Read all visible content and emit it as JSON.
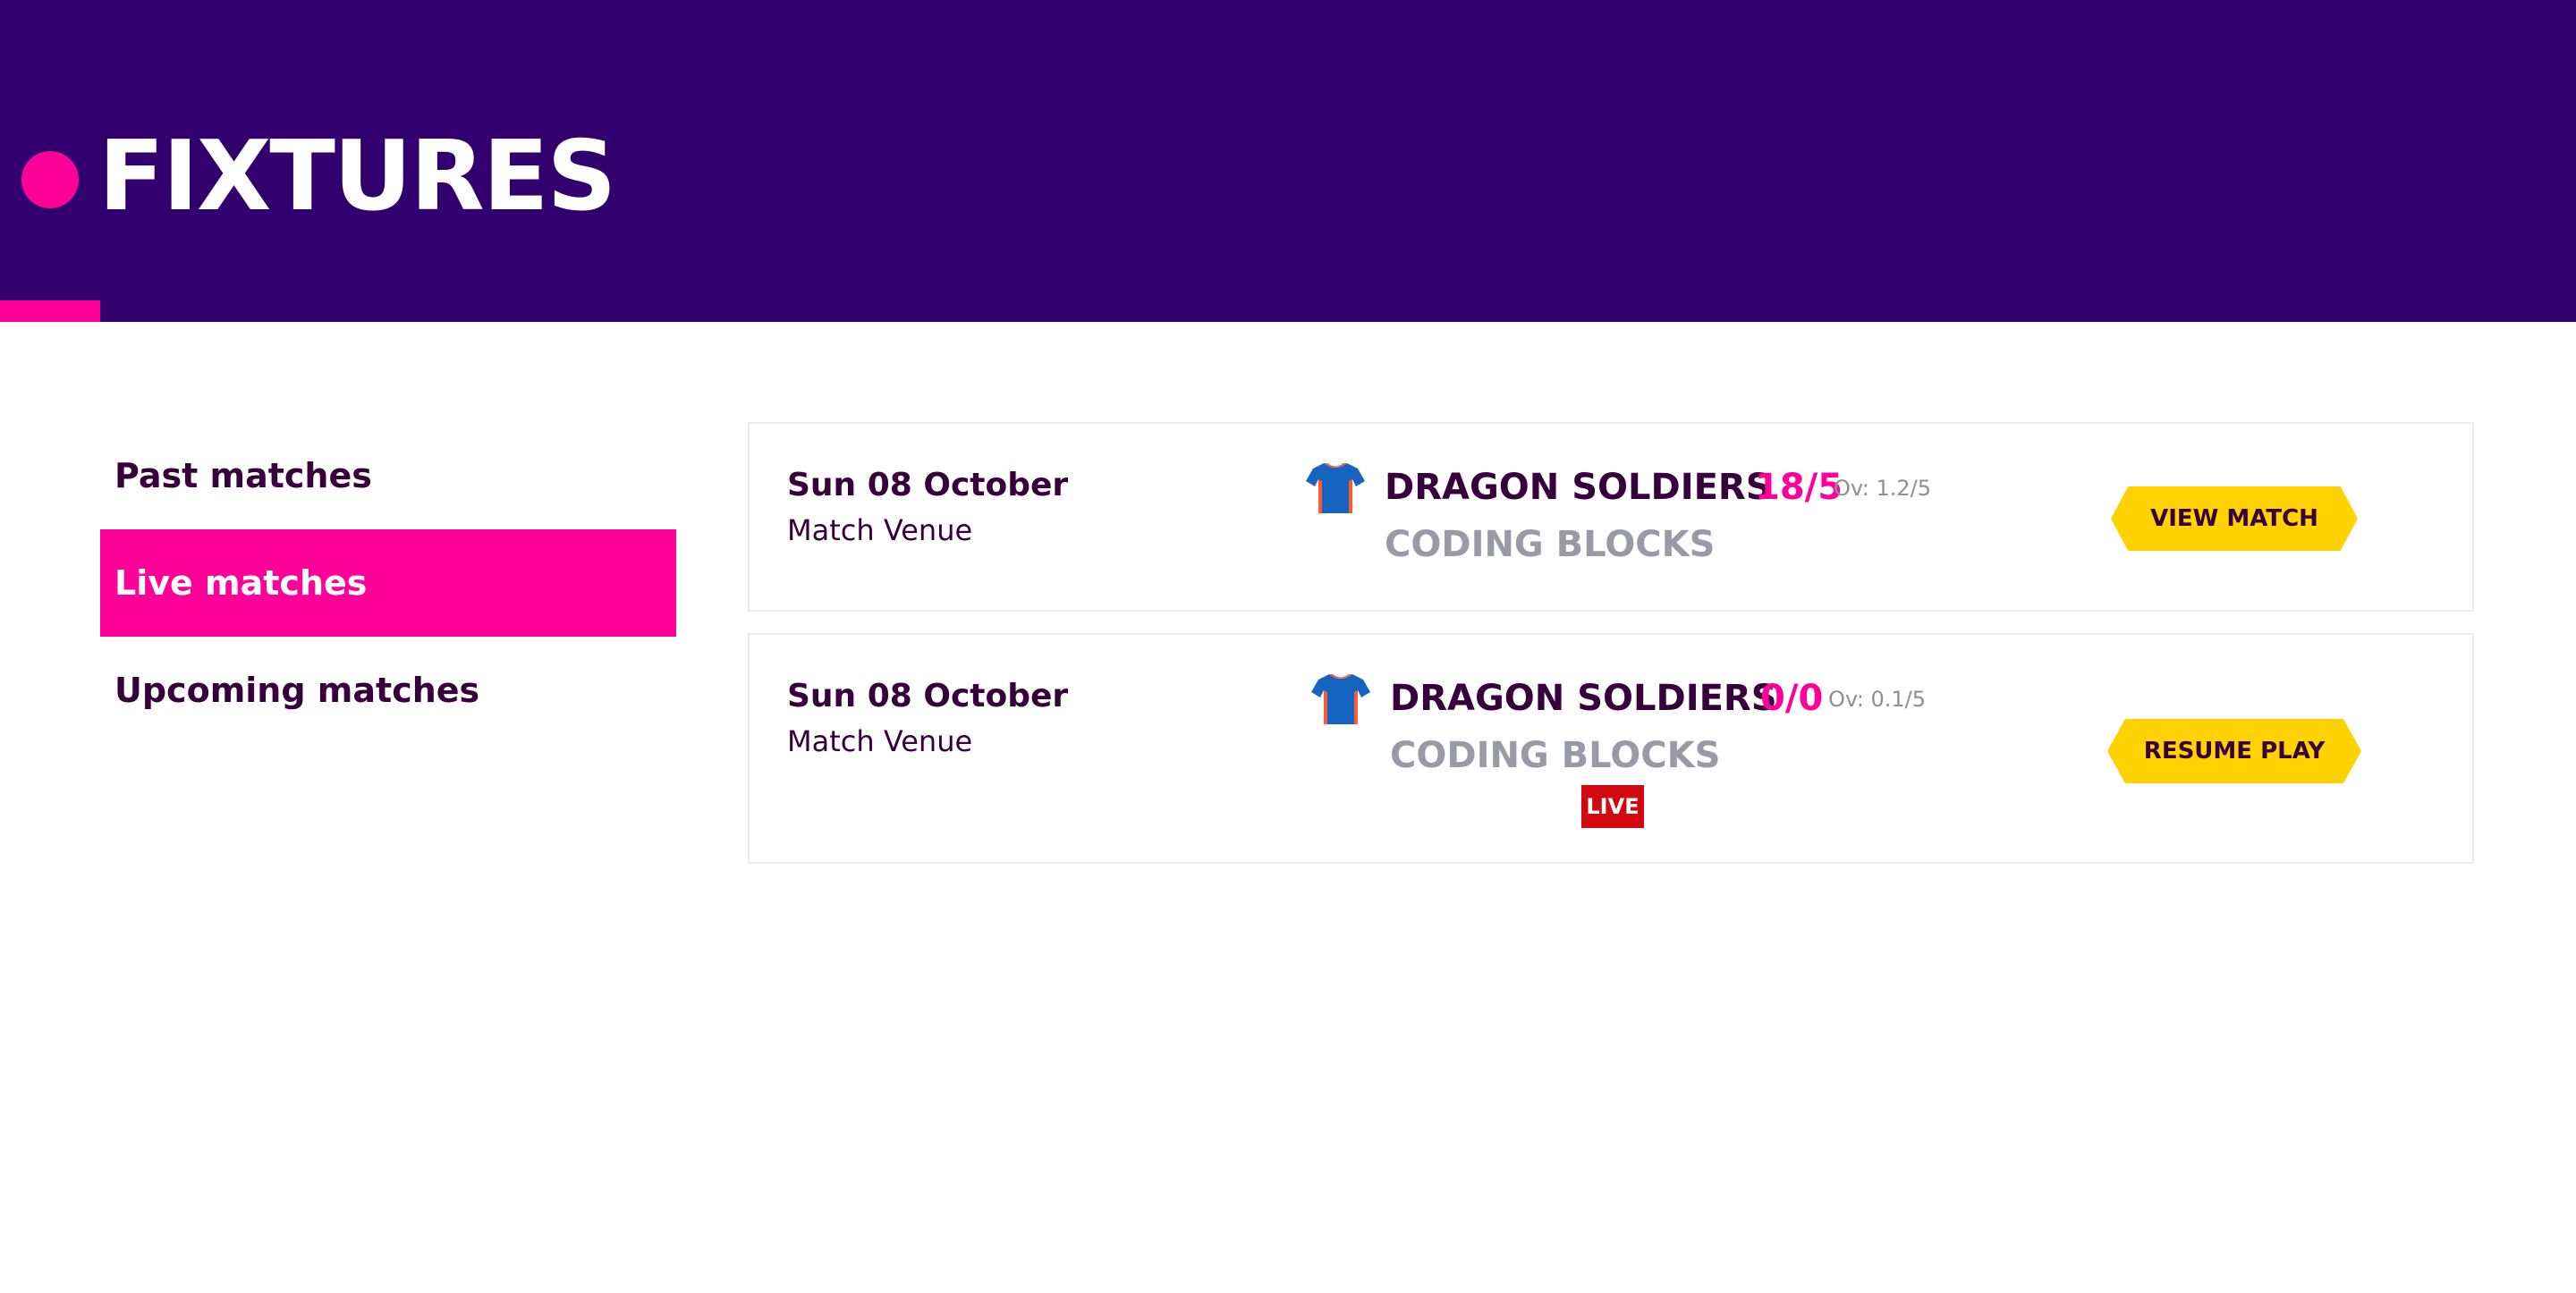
{
  "header": {
    "title": "FIXTURES"
  },
  "sidebar": {
    "items": [
      {
        "label": "Past matches",
        "active": false
      },
      {
        "label": "Live matches",
        "active": true
      },
      {
        "label": "Upcoming matches",
        "active": false
      }
    ]
  },
  "matches": [
    {
      "date": "Sun 08 October",
      "venue": "Match Venue",
      "team_a": "DRAGON SOLDIERS",
      "team_b": "CODING BLOCKS",
      "score": "18/5",
      "overs": "Ov: 1.2/5",
      "live": false,
      "action_label": "VIEW MATCH"
    },
    {
      "date": "Sun 08 October",
      "venue": "Match Venue",
      "team_a": "DRAGON SOLDIERS",
      "team_b": "CODING BLOCKS",
      "score": "0/0",
      "overs": "Ov: 0.1/5",
      "live": true,
      "live_label": "LIVE",
      "action_label": "RESUME PLAY"
    }
  ],
  "icons": {
    "team": "jersey-icon"
  },
  "colors": {
    "header_bg": "#32006e",
    "accent_pink": "#ff0099",
    "button_yellow": "#ffd200",
    "live_red": "#d10a11"
  }
}
